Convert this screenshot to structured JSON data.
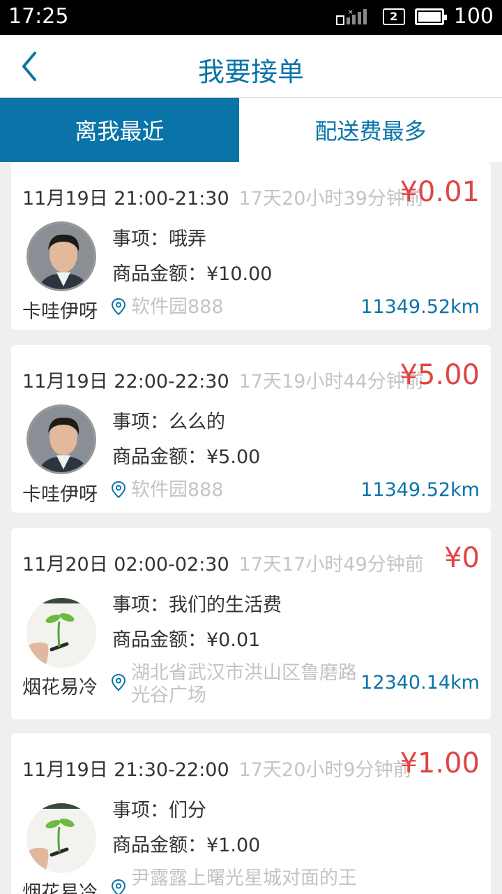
{
  "status_bar": {
    "time": "17:25",
    "sim": "2",
    "battery": "100",
    "battery_level": 1.0
  },
  "header": {
    "title": "我要接单",
    "back_icon": "chevron-left-icon"
  },
  "tabs": [
    {
      "label": "离我最近",
      "active": true
    },
    {
      "label": "配送费最多",
      "active": false
    }
  ],
  "orders": [
    {
      "time": "11月19日 21:00-21:30",
      "ago": "17天20小时39分钟前",
      "price": "¥0.01",
      "item": "事项：哦弄",
      "amount": "商品金额：¥10.00",
      "name": "卡哇伊呀",
      "address": "软件园888",
      "distance": "11349.52km",
      "avatar": "man-portrait"
    },
    {
      "time": "11月19日 22:00-22:30",
      "ago": "17天19小时44分钟前",
      "price": "¥5.00",
      "item": "事项：么么的",
      "amount": "商品金额：¥5.00",
      "name": "卡哇伊呀",
      "address": "软件园888",
      "distance": "11349.52km",
      "avatar": "man-portrait"
    },
    {
      "time": "11月20日 02:00-02:30",
      "ago": "17天17小时49分钟前",
      "price": "¥0",
      "item": "事项：我们的生活费",
      "amount": "商品金额：¥0.01",
      "name": "烟花易冷",
      "address": "湖北省武汉市洪山区鲁磨路光谷广场",
      "distance": "12340.14km",
      "avatar": "sprout-photo"
    },
    {
      "time": "11月19日 21:30-22:00",
      "ago": "17天20小时9分钟前",
      "price": "¥1.00",
      "item": "事项：们分",
      "amount": "商品金额：¥1.00",
      "name": "烟花易冷",
      "address": "尹露露上曙光星城对面的王",
      "distance": "",
      "avatar": "sprout-photo"
    }
  ],
  "colors": {
    "accent": "#0a74a8",
    "price": "#e04545",
    "muted": "#c4c4c4",
    "background": "#efefef"
  }
}
